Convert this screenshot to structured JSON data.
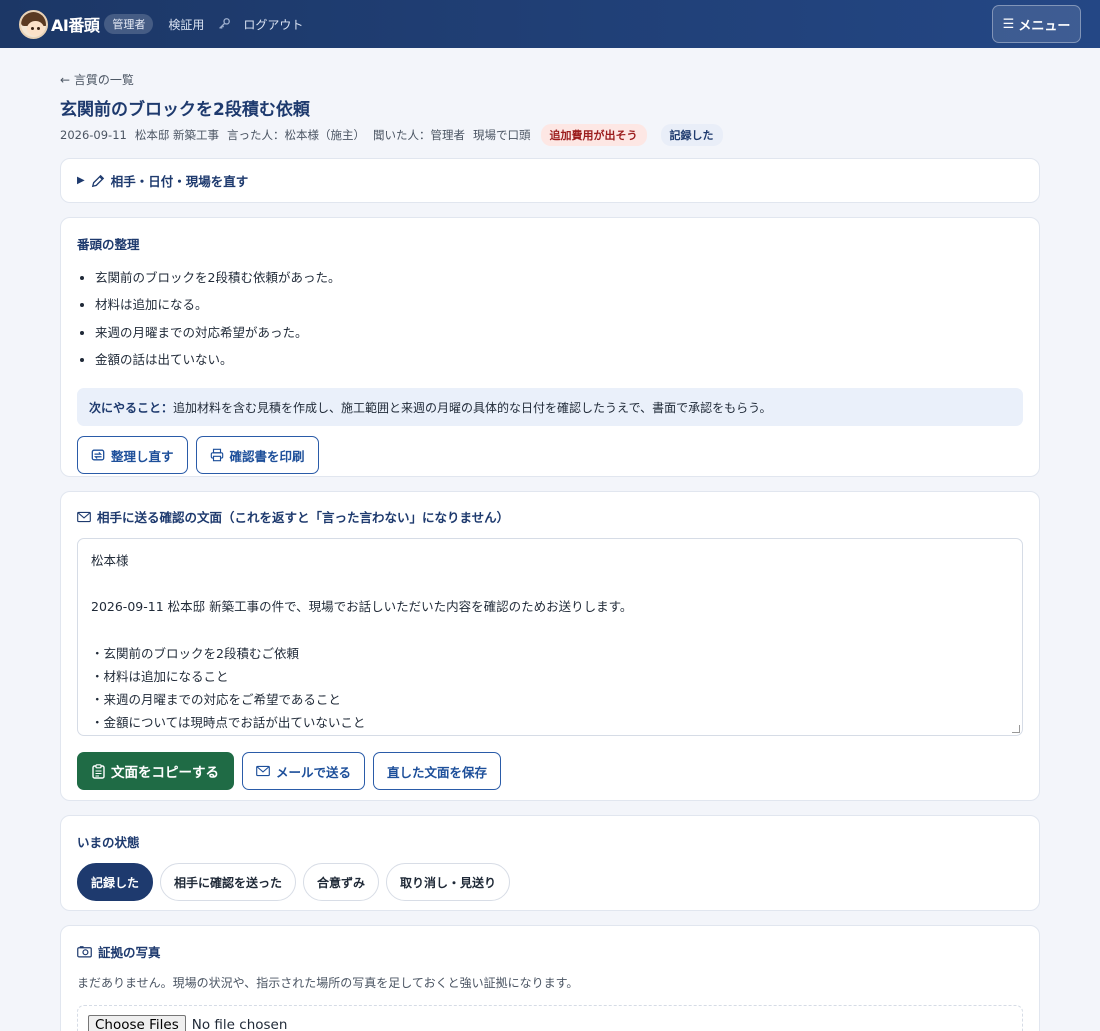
{
  "header": {
    "brand": "AI番頭",
    "role": "管理者",
    "nav_verify": "検証用",
    "nav_logout": "ログアウト",
    "menu_label": "メニュー"
  },
  "page": {
    "back_link": "← 言質の一覧",
    "title": "玄関前のブロックを2段積む依頼",
    "meta": {
      "date": "2026-09-11",
      "project": "松本邸 新築工事",
      "speaker": "言った人：松本様（施主）",
      "listener": "聞いた人：管理者",
      "method": "現場で口頭",
      "badge_warning": "追加費用が出そう",
      "badge_status": "記録した"
    }
  },
  "edit_section": {
    "label": "相手・日付・現場を直す"
  },
  "summary": {
    "title": "番頭の整理",
    "bullets": [
      "玄関前のブロックを2段積む依頼があった。",
      "材料は追加になる。",
      "来週の月曜までの対応希望があった。",
      "金額の話は出ていない。"
    ],
    "next_label": "次にやること：",
    "next_text": "追加材料を含む見積を作成し、施工範囲と来週の月曜の具体的な日付を確認したうえで、書面で承認をもらう。",
    "btn_reorganize": "整理し直す",
    "btn_print": "確認書を印刷"
  },
  "message": {
    "title": "相手に送る確認の文面（これを返すと「言った言わない」になりません）",
    "lines": [
      "松本様",
      "",
      "2026-09-11 松本邸 新築工事の件で、現場でお話しいただいた内容を確認のためお送りします。",
      "",
      "・玄関前のブロックを2段積むご依頼",
      "・材料は追加になること",
      "・来週の月曜までの対応をご希望であること",
      "・金額については現時点でお話が出ていないこと"
    ],
    "btn_copy": "文面をコピーする",
    "btn_mail": "メールで送る",
    "btn_save": "直した文面を保存"
  },
  "status": {
    "title": "いまの状態",
    "options": [
      "記録した",
      "相手に確認を送った",
      "合意ずみ",
      "取り消し・見送り"
    ],
    "active_index": 0
  },
  "photos": {
    "title": "証拠の写真",
    "description": "まだありません。現場の状況や、指示された場所の写真を足しておくと強い証拠になります。",
    "choose_label": "Choose Files",
    "no_file": "No file chosen"
  },
  "colors": {
    "header_bg": "#1c3766",
    "accent": "#1e3a6e",
    "primary_green": "#1f6b45",
    "warning_bg": "#fde7e4"
  }
}
